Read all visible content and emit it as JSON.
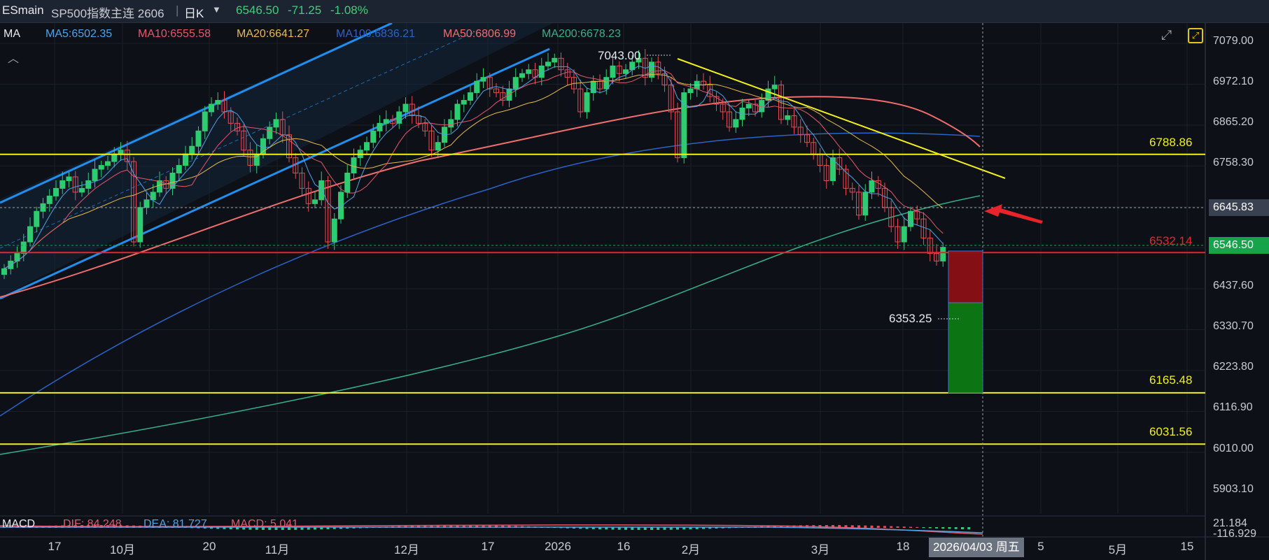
{
  "header": {
    "symbol": "ESmain",
    "name": "SP500指数主连 2606",
    "period": "日K",
    "dropdown_icon": "chevron-down-icon",
    "last": "6546.50",
    "change": "-71.25",
    "change_pct": "-1.08%"
  },
  "ma_legend": {
    "label": "MA",
    "items": [
      {
        "text": "MA5:6502.35",
        "color": "#4fa3e6"
      },
      {
        "text": "MA10:6555.58",
        "color": "#e4576d"
      },
      {
        "text": "MA20:6641.27",
        "color": "#e7b94c"
      },
      {
        "text": "MA100:6836.21",
        "color": "#2b63c9"
      },
      {
        "text": "MA50:6806.99",
        "color": "#f06d6d"
      },
      {
        "text": "MA200:6678.23",
        "color": "#35b08a"
      }
    ]
  },
  "y_axis": {
    "labels": [
      "7079.00",
      "6972.10",
      "6865.20",
      "6758.30",
      "6645.83",
      "6546.50",
      "6437.60",
      "6330.70",
      "6223.80",
      "6116.90",
      "6010.00",
      "5903.10"
    ]
  },
  "levels": [
    {
      "value": 6788.86,
      "text": "6788.86",
      "color": "#f2ef1d"
    },
    {
      "value": 6532.14,
      "text": "6532.14",
      "color": "#e8242a"
    },
    {
      "value": 6165.48,
      "text": "6165.48",
      "color": "#f2ef1d"
    },
    {
      "value": 6031.56,
      "text": "6031.56",
      "color": "#f2ef1d"
    }
  ],
  "annotations": {
    "high": "7043.00",
    "low": "6353.25",
    "crosshair_price": "6645.83",
    "current_price": "6546.50"
  },
  "macd": {
    "label": "MACD",
    "dif": "DIF: 84.248",
    "dea": "DEA: 81.727",
    "macd": "MACD: 5.041",
    "scale_top": "21.184",
    "scale_bottom": "-116.929"
  },
  "x_axis": {
    "labels": [
      "17",
      "10月",
      "20",
      "11月",
      "12月",
      "17",
      "2026",
      "16",
      "2月",
      "3月",
      "18",
      "5",
      "5月",
      "15"
    ],
    "crosshair_date": "2026/04/03 周五"
  },
  "colors": {
    "up": "#2ecc71",
    "down": "#e84a57",
    "background": "#0d1117",
    "channel": "#1f8ff0",
    "trend": "#f2ef1d"
  },
  "chart_data": {
    "type": "candlestick",
    "title": "SP500指数主连 2606 日K",
    "ylim": [
      5850,
      7130
    ],
    "visible_high": 7043.0,
    "visible_low": 6353.25,
    "last_close": 6546.5,
    "levels": [
      6788.86,
      6532.14,
      6165.48,
      6031.56
    ],
    "y_ticks": [
      7079.0,
      6972.1,
      6865.2,
      6758.3,
      6645.83,
      6546.5,
      6437.6,
      6330.7,
      6223.8,
      6116.9,
      6010.0,
      5903.1
    ],
    "x_ticks": [
      "17",
      "10月",
      "20",
      "11月",
      "12月",
      "17",
      "2026",
      "16",
      "2月",
      "3月",
      "18",
      "5",
      "5月",
      "15"
    ],
    "ma": {
      "MA5": 6502.35,
      "MA10": 6555.58,
      "MA20": 6641.27,
      "MA100": 6836.21,
      "MA50": 6806.99,
      "MA200": 6678.23
    },
    "closes": [
      6490,
      6510,
      6530,
      6560,
      6600,
      6640,
      6660,
      6680,
      6700,
      6720,
      6730,
      6690,
      6700,
      6720,
      6750,
      6760,
      6770,
      6790,
      6800,
      6770,
      6560,
      6650,
      6670,
      6690,
      6720,
      6700,
      6740,
      6760,
      6790,
      6810,
      6850,
      6900,
      6920,
      6930,
      6900,
      6870,
      6850,
      6800,
      6760,
      6790,
      6830,
      6860,
      6880,
      6840,
      6780,
      6740,
      6700,
      6660,
      6670,
      6720,
      6560,
      6620,
      6690,
      6740,
      6780,
      6800,
      6820,
      6850,
      6870,
      6880,
      6870,
      6900,
      6920,
      6890,
      6870,
      6850,
      6800,
      6820,
      6860,
      6880,
      6920,
      6930,
      6950,
      6980,
      6990,
      6960,
      6950,
      6930,
      6960,
      6990,
      7000,
      7010,
      6990,
      7020,
      7030,
      7040,
      7010,
      6990,
      6960,
      6900,
      6950,
      6980,
      6960,
      6990,
      7020,
      7000,
      7010,
      7030,
      7040,
      6990,
      7030,
      7000,
      6970,
      6900,
      6780,
      6950,
      6960,
      6980,
      6970,
      6940,
      6920,
      6900,
      6860,
      6880,
      6910,
      6920,
      6900,
      6930,
      6960,
      6970,
      6880,
      6890,
      6860,
      6840,
      6820,
      6790,
      6760,
      6720,
      6780,
      6750,
      6700,
      6690,
      6630,
      6690,
      6720,
      6700,
      6650,
      6600,
      6560,
      6600,
      6640,
      6620,
      6570,
      6530,
      6510,
      6546
    ]
  }
}
